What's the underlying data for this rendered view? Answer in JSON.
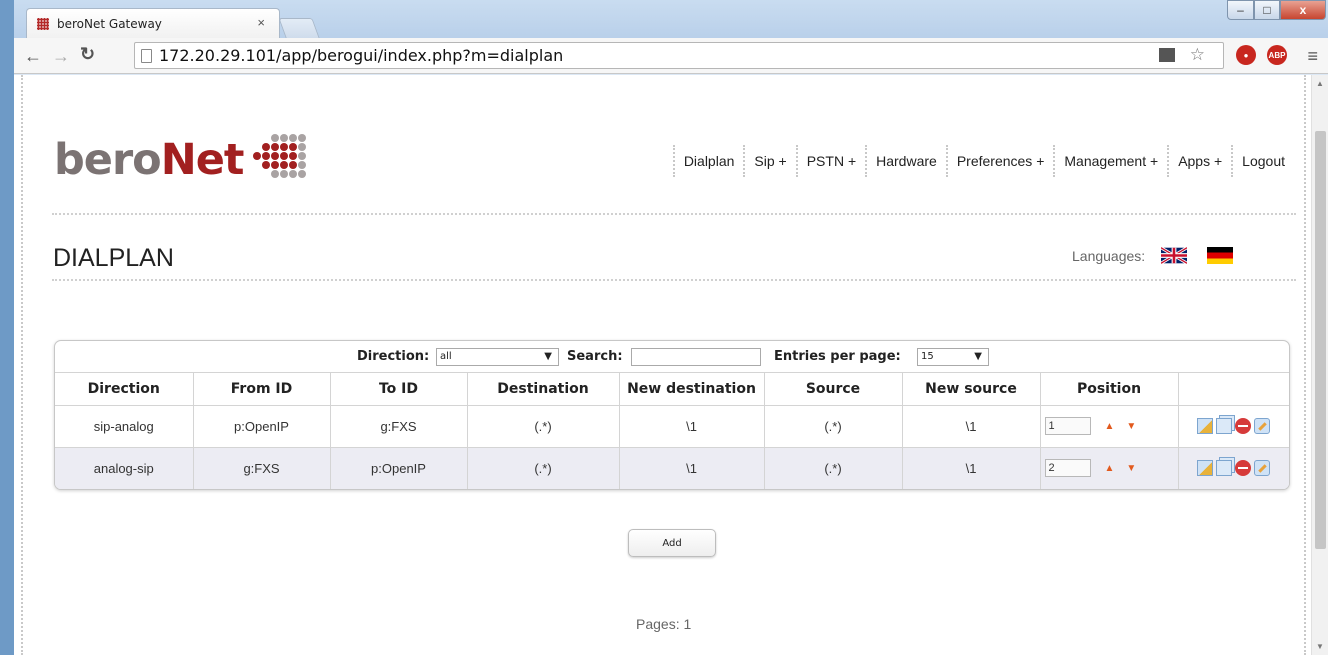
{
  "browser": {
    "tab_title": "beroNet Gateway",
    "tab_close": "×",
    "url": "172.20.29.101/app/berogui/index.php?m=dialplan",
    "window_controls": {
      "minimize": "–",
      "maximize": "□",
      "close": "x"
    },
    "extensions": {
      "abp": "ABP"
    }
  },
  "logo": {
    "part1": "bero",
    "part2": "Net"
  },
  "nav": {
    "items": [
      "Dialplan",
      "Sip +",
      "PSTN +",
      "Hardware",
      "Preferences +",
      "Management +",
      "Apps +",
      "Logout"
    ]
  },
  "page": {
    "title": "DIALPLAN",
    "languages_label": "Languages:"
  },
  "filter": {
    "direction_label": "Direction:",
    "direction_value": "all",
    "search_label": "Search:",
    "search_value": "",
    "entries_label": "Entries per page:",
    "entries_value": "15"
  },
  "table": {
    "columns": [
      "Direction",
      "From ID",
      "To ID",
      "Destination",
      "New destination",
      "Source",
      "New source",
      "Position",
      ""
    ],
    "rows": [
      {
        "direction": "sip-analog",
        "from_id": "p:OpenIP",
        "to_id": "g:FXS",
        "destination": "(.*)",
        "new_destination": "\\1",
        "source": "(.*)",
        "new_source": "\\1",
        "position": "1"
      },
      {
        "direction": "analog-sip",
        "from_id": "g:FXS",
        "to_id": "p:OpenIP",
        "destination": "(.*)",
        "new_destination": "\\1",
        "source": "(.*)",
        "new_source": "\\1",
        "position": "2"
      }
    ]
  },
  "add_label": "Add",
  "pages_text": "Pages: 1",
  "colors": {
    "brand_red": "#a22020",
    "brand_gray": "#7b7373",
    "arrow_orange": "#e25a1e",
    "row_alt": "#ececf3"
  }
}
